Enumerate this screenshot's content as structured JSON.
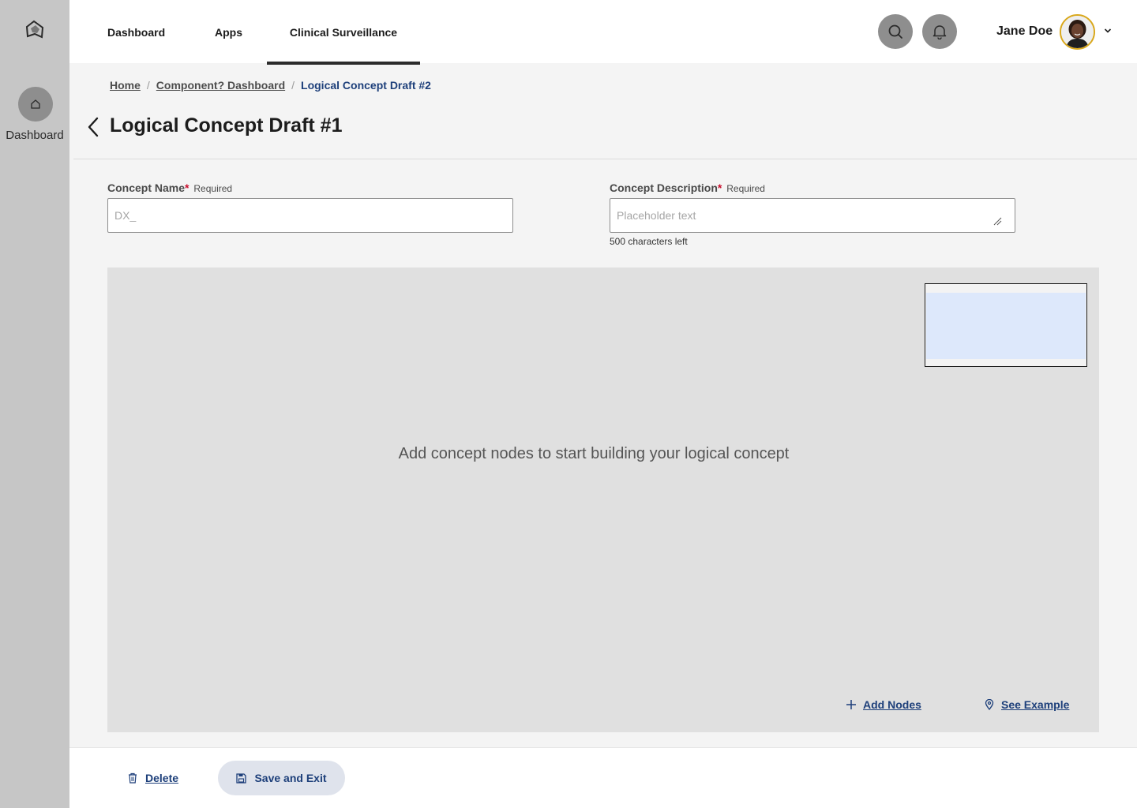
{
  "rail": {
    "logo_icon": "app-logo-icon",
    "items": [
      {
        "label": "Dashboard",
        "icon": "home-icon"
      }
    ]
  },
  "nav": {
    "tabs": [
      {
        "label": "Dashboard",
        "active": false
      },
      {
        "label": "Apps",
        "active": false
      },
      {
        "label": "Clinical Surveillance",
        "active": true
      }
    ]
  },
  "header": {
    "search_icon": "search-icon",
    "notification_icon": "bell-icon",
    "user_name": "Jane Doe",
    "user_menu_icon": "chevron-down-icon"
  },
  "breadcrumb": {
    "items": [
      "Home",
      "Component? Dashboard",
      "Logical Concept Draft #2"
    ],
    "separator": "/"
  },
  "page": {
    "title": "Logical Concept Draft #1"
  },
  "form": {
    "concept_name": {
      "label": "Concept Name",
      "required_mark": "*",
      "required_text": "Required",
      "placeholder": "DX_",
      "value": ""
    },
    "concept_description": {
      "label": "Concept Description",
      "required_mark": "*",
      "required_text": "Required",
      "placeholder": "Placeholder text",
      "value": "",
      "helper": "500 characters left"
    }
  },
  "canvas": {
    "empty_message": "Add concept nodes to start building your logical concept",
    "add_nodes_label": "Add Nodes",
    "see_example_label": "See Example"
  },
  "footer": {
    "delete_label": "Delete",
    "save_label": "Save and Exit"
  },
  "colors": {
    "accent": "#1d3f7a",
    "rail": "#c6c6c6",
    "required": "#c8102e",
    "canvas": "#e0e0e0"
  }
}
